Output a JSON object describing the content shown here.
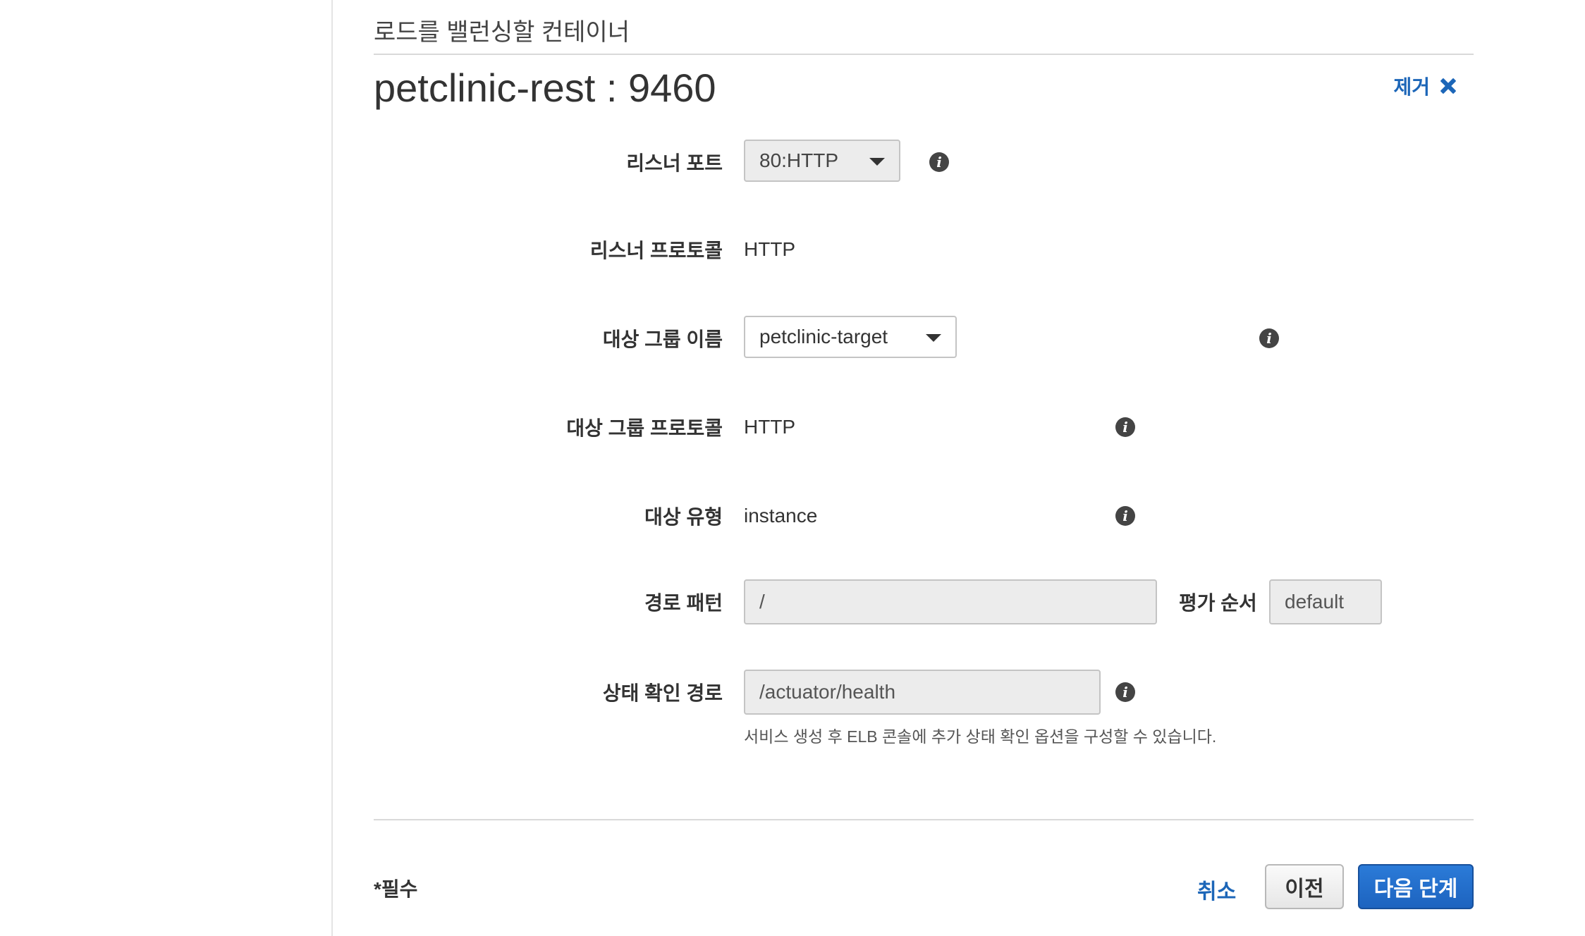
{
  "section": {
    "heading": "로드를 밸런싱할 컨테이너"
  },
  "container": {
    "title": "petclinic-rest : 9460",
    "remove_label": "제거"
  },
  "form": {
    "listener_port": {
      "label": "리스너 포트",
      "value": "80:HTTP"
    },
    "listener_protocol": {
      "label": "리스너 프로토콜",
      "value": "HTTP"
    },
    "target_group_name": {
      "label": "대상 그룹 이름",
      "value": "petclinic-target"
    },
    "target_group_protocol": {
      "label": "대상 그룹 프로토콜",
      "value": "HTTP"
    },
    "target_type": {
      "label": "대상 유형",
      "value": "instance"
    },
    "path_pattern": {
      "label": "경로 패턴",
      "value": "/"
    },
    "evaluation_order": {
      "label": "평가 순서",
      "placeholder": "default"
    },
    "health_check_path": {
      "label": "상태 확인 경로",
      "value": "/actuator/health",
      "hint": "서비스 생성 후 ELB 콘솔에 추가 상태 확인 옵션을 구성할 수 있습니다."
    },
    "info_icon_glyph": "i"
  },
  "footer": {
    "required_note": "*필수",
    "cancel_label": "취소",
    "previous_label": "이전",
    "next_label": "다음 단계"
  },
  "colors": {
    "link_blue": "#1c66b8",
    "primary_button": "#1d63bf",
    "input_grey": "#ececec"
  }
}
